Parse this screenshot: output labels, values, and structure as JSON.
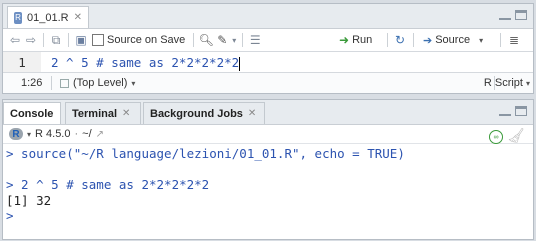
{
  "source": {
    "tab": {
      "filename": "01_01.R"
    },
    "toolbar": {
      "source_on_save": "Source on Save",
      "run": "Run",
      "source": "Source"
    },
    "editor": {
      "line_number": "1",
      "code": "2 ^ 5 # same as 2*2*2*2*2"
    },
    "status": {
      "position": "1:26",
      "scope": "(Top Level)",
      "filetype": "R Script"
    }
  },
  "console": {
    "tabs": [
      {
        "label": "Console"
      },
      {
        "label": "Terminal"
      },
      {
        "label": "Background Jobs"
      }
    ],
    "r_version": "R 4.5.0",
    "working_dir": "~/",
    "lines": [
      "> source(\"~/R language/lezioni/01_01.R\", echo = TRUE)",
      "",
      "> 2 ^ 5 # same as 2*2*2*2*2",
      "[1] 32",
      ">"
    ]
  },
  "colors": {
    "code_blue": "#2c53b0",
    "panel_bg": "#e7ebef",
    "accent_green": "#3a9a3a"
  }
}
